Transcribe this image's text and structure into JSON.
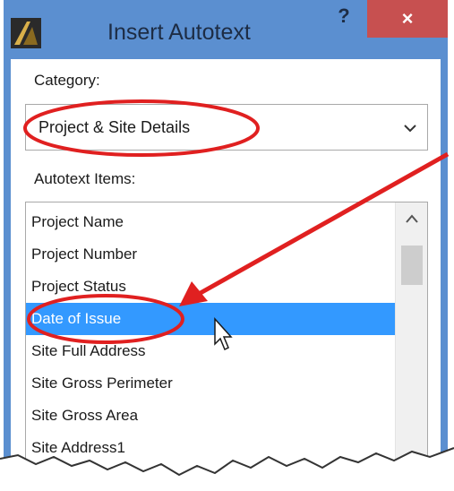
{
  "window": {
    "title": "Insert Autotext",
    "help_label": "?",
    "close_label": "×"
  },
  "category": {
    "label": "Category:",
    "selected": "Project & Site Details"
  },
  "autotext": {
    "label": "Autotext Items:",
    "items": [
      "Project Name",
      "Project Number",
      "Project Status",
      "Date of Issue",
      "Site Full Address",
      "Site Gross Perimeter",
      "Site Gross Area",
      "Site Address1"
    ],
    "selected_index": 3
  },
  "icons": {
    "app": "archicad-logo-icon",
    "dropdown": "chevron-down-icon",
    "cursor": "mouse-pointer-icon"
  },
  "colors": {
    "title_bar": "#5b8fd0",
    "close_button": "#c75050",
    "selection": "#3399ff",
    "annotation": "#e02020"
  }
}
